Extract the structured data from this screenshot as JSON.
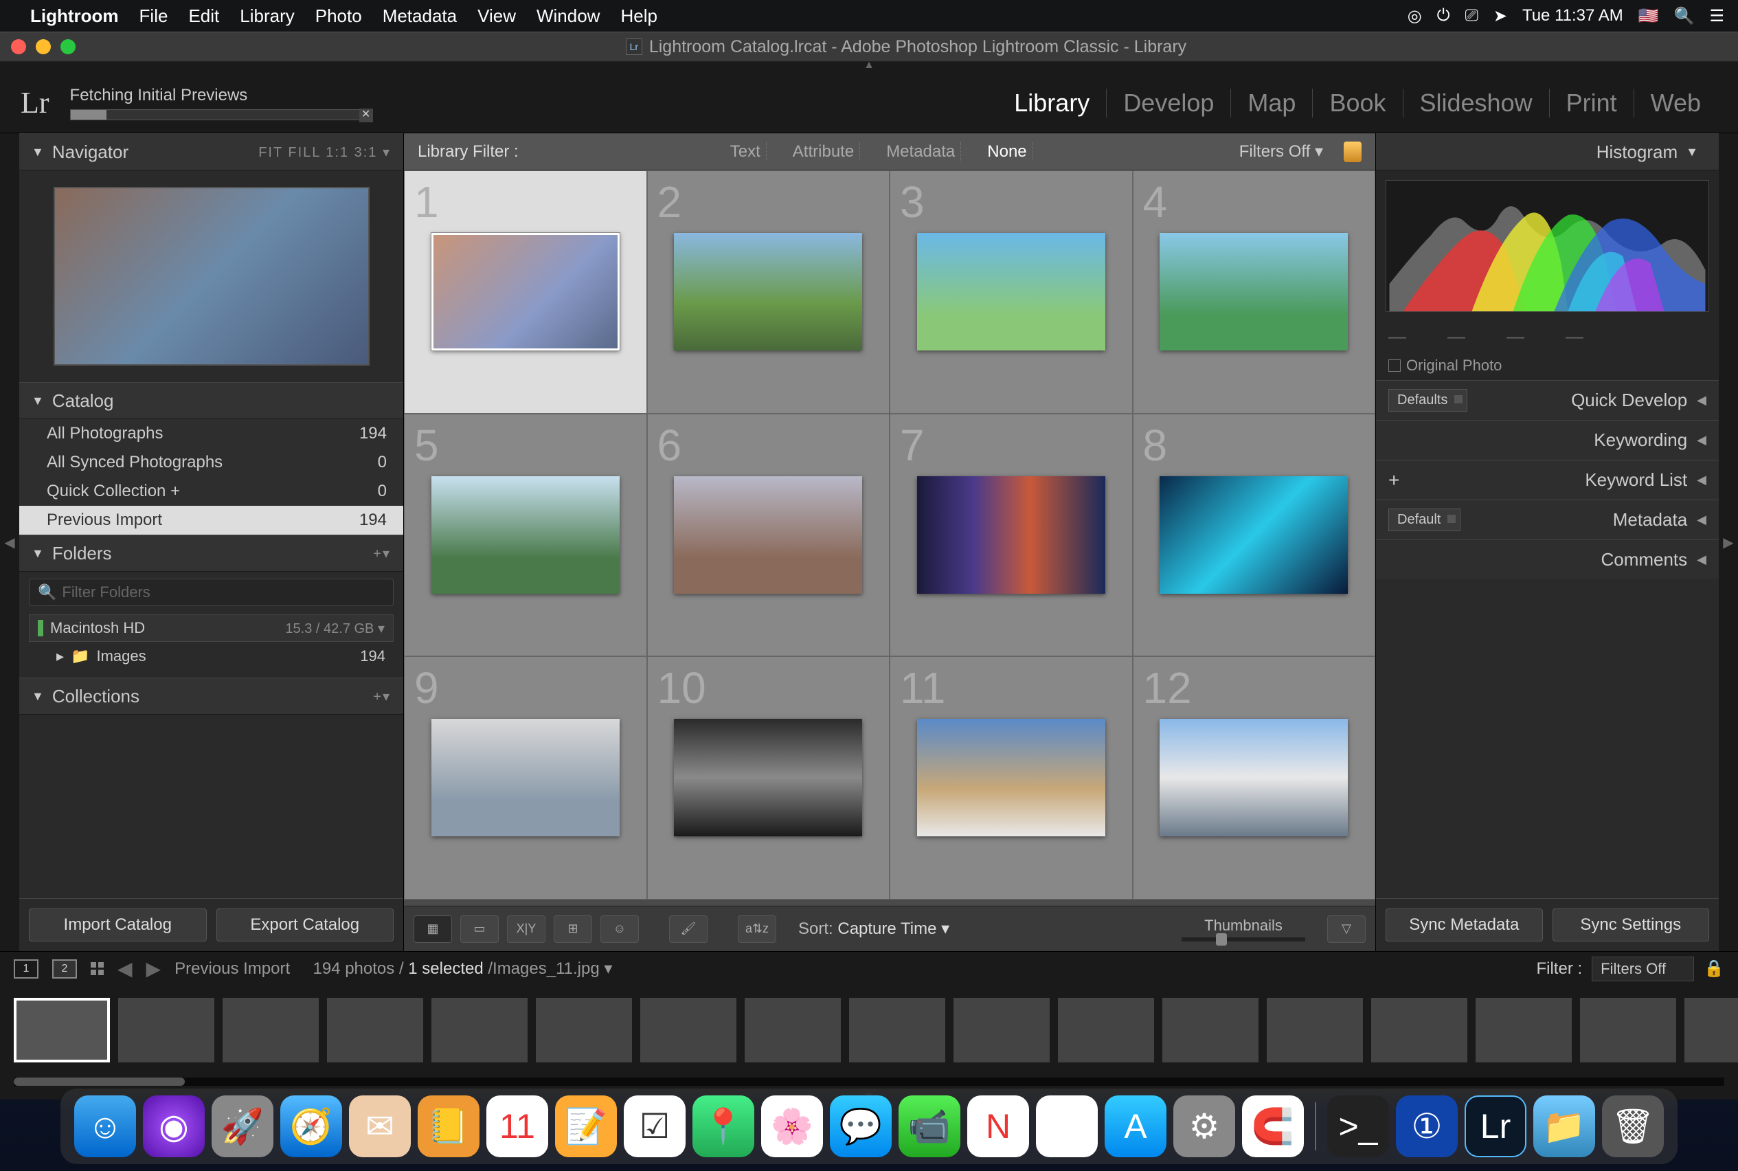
{
  "menubar": {
    "app": "Lightroom",
    "items": [
      "File",
      "Edit",
      "Library",
      "Photo",
      "Metadata",
      "View",
      "Window",
      "Help"
    ],
    "time": "Tue 11:37 AM"
  },
  "window_title": "Lightroom Catalog.lrcat - Adobe Photoshop Lightroom Classic - Library",
  "topbar": {
    "logo": "Lr",
    "status": "Fetching Initial Previews",
    "modules": [
      "Library",
      "Develop",
      "Map",
      "Book",
      "Slideshow",
      "Print",
      "Web"
    ],
    "active_module": "Library"
  },
  "left": {
    "navigator": {
      "title": "Navigator",
      "opts": "FIT  FILL  1:1  3:1 ▾"
    },
    "catalog": {
      "title": "Catalog",
      "items": [
        {
          "label": "All Photographs",
          "count": "194"
        },
        {
          "label": "All Synced Photographs",
          "count": "0"
        },
        {
          "label": "Quick Collection  +",
          "count": "0"
        },
        {
          "label": "Previous Import",
          "count": "194",
          "sel": true
        }
      ]
    },
    "folders": {
      "title": "Folders",
      "filter_placeholder": "Filter Folders",
      "volume": "Macintosh HD",
      "volume_size": "15.3 / 42.7 GB ▾",
      "folder": "Images",
      "folder_count": "194"
    },
    "collections": {
      "title": "Collections"
    },
    "buttons": {
      "import": "Import Catalog",
      "export": "Export Catalog"
    }
  },
  "filterbar": {
    "label": "Library Filter :",
    "options": [
      "Text",
      "Attribute",
      "Metadata",
      "None"
    ],
    "active": "None",
    "filters_off": "Filters Off ▾"
  },
  "grid": {
    "cells": [
      1,
      2,
      3,
      4,
      5,
      6,
      7,
      8,
      9,
      10,
      11,
      12
    ],
    "selected": 1
  },
  "toolbar": {
    "sort_label": "Sort:",
    "sort_value": "Capture Time ▾",
    "thumbnails": "Thumbnails"
  },
  "right": {
    "histogram": "Histogram",
    "original": "Original Photo",
    "quick_develop": {
      "dd": "Defaults",
      "label": "Quick Develop"
    },
    "keywording": "Keywording",
    "keyword_list": "Keyword List",
    "metadata": {
      "dd": "Default",
      "label": "Metadata"
    },
    "comments": "Comments",
    "sync_meta": "Sync Metadata",
    "sync_settings": "Sync Settings"
  },
  "filmstrip": {
    "source": "Previous Import",
    "count": "194 photos /",
    "selected": "1 selected",
    "file": "/Images_11.jpg ▾",
    "filter_label": "Filter :",
    "filter_value": "Filters Off"
  }
}
